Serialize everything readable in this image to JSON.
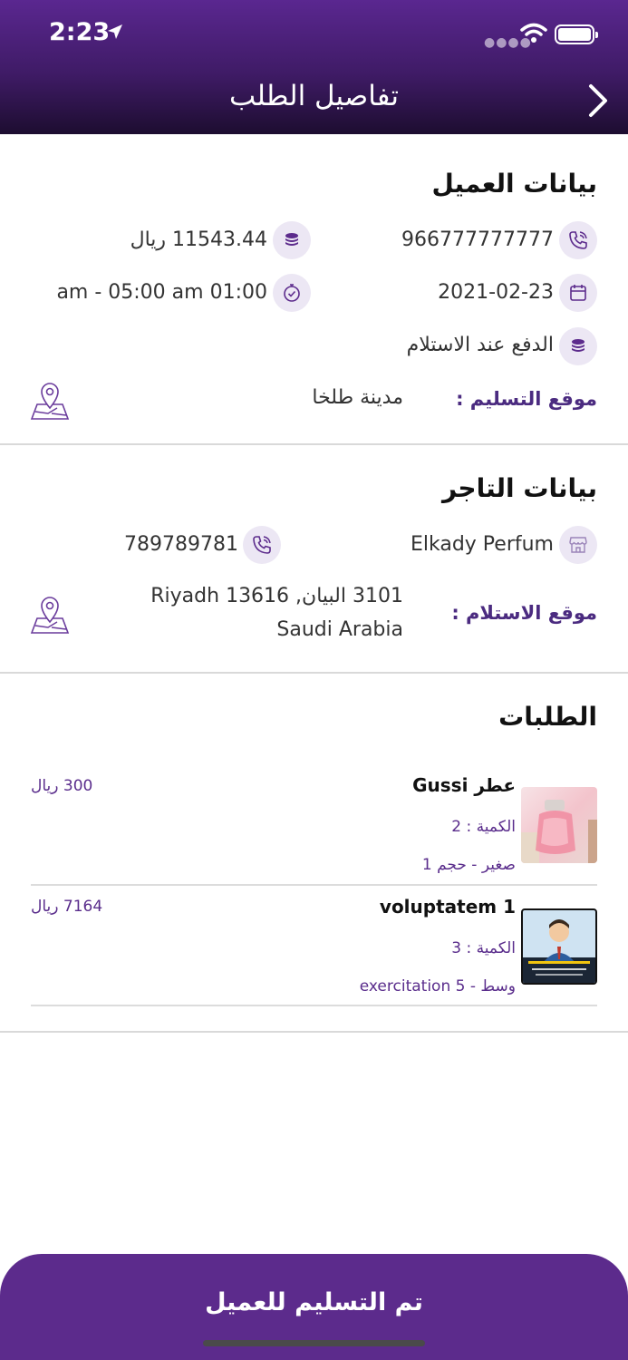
{
  "status_bar": {
    "time": "2:23"
  },
  "header": {
    "title": "تفاصيل الطلب"
  },
  "customer": {
    "title": "بيانات العميل",
    "phone": "966777777777",
    "amount": "11543.44 ريال",
    "date": "2021-02-23",
    "time_window": "01:00 am - 05:00 am",
    "payment_method": "الدفع عند الاستلام",
    "delivery_label": "موقع التسليم :",
    "delivery_value": "مدينة طلخا"
  },
  "merchant": {
    "title": "بيانات التاجر",
    "name": "Elkady Perfum",
    "phone": "789789781",
    "pickup_label": "موقع الاستلام :",
    "pickup_line1": "3101 البيان, Riyadh 13616",
    "pickup_line2": "Saudi Arabia"
  },
  "orders": {
    "title": "الطلبات",
    "items": [
      {
        "name": "عطر Gussi",
        "quantity": "الكمية : 2",
        "variant": "صغير - حجم 1",
        "price": "300 ريال"
      },
      {
        "name": "voluptatem 1",
        "quantity": "الكمية : 3",
        "variant": "وسط - exercitation 5",
        "price": "7164 ريال"
      }
    ]
  },
  "footer": {
    "button_label": "تم التسليم للعميل"
  },
  "colors": {
    "brand": "#5c2b8c",
    "icon_bg": "#ece7f4"
  }
}
